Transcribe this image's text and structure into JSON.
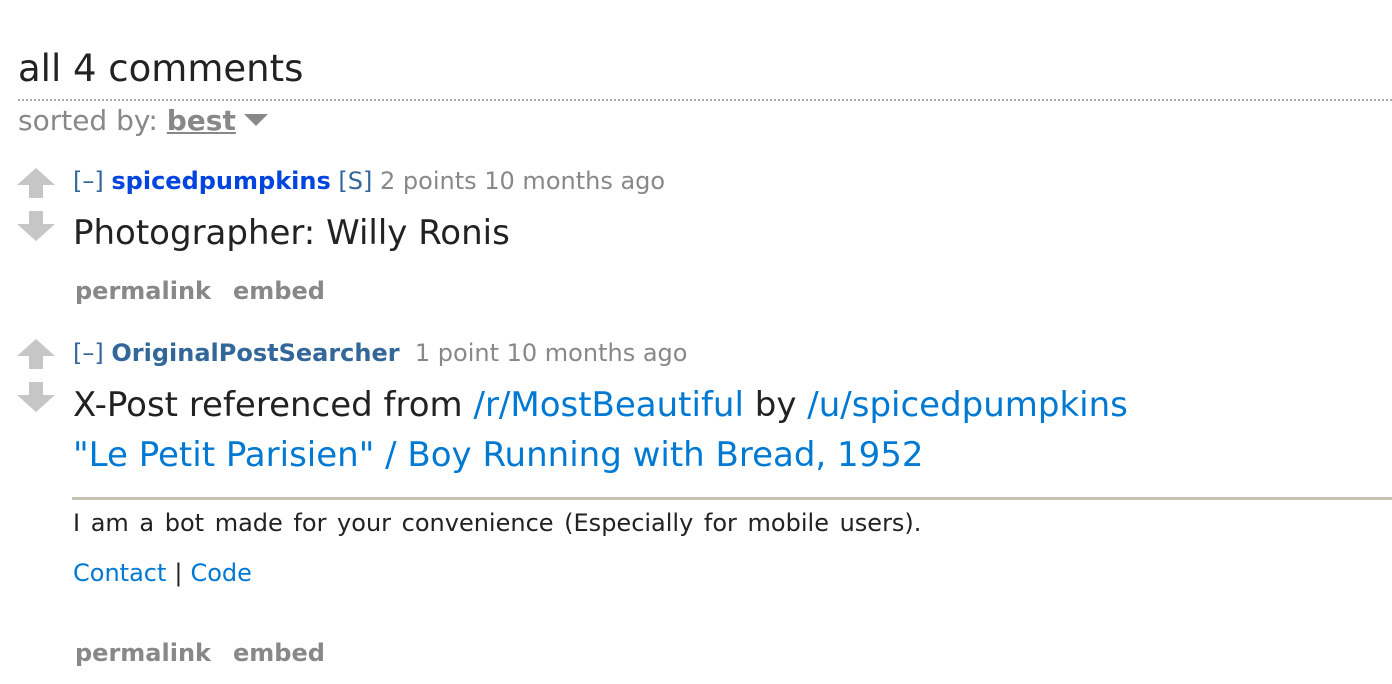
{
  "header": {
    "title": "all 4 comments",
    "sort_label": "sorted by: ",
    "sort_value": "best"
  },
  "comments": [
    {
      "expand": "[–]",
      "author": "spicedpumpkins",
      "submitter_tag": "[S]",
      "score": "2 points",
      "time": "10 months ago",
      "body": "Photographer: Willy Ronis",
      "buttons": [
        "permalink",
        "embed"
      ]
    },
    {
      "expand": "[–]",
      "author": "OriginalPostSearcher",
      "score": "1 point",
      "time": "10 months ago",
      "body_prefix": "X-Post referenced from ",
      "subreddit_link": "/r/MostBeautiful",
      "body_middle": " by ",
      "user_link": "/u/spicedpumpkins",
      "post_link": "\"Le Petit Parisien\" / Boy Running with Bread, 1952",
      "bot_note": "I am a bot made for your convenience (Especially for mobile users).",
      "footer_links": [
        "Contact",
        "Code"
      ],
      "footer_separator": "|",
      "buttons": [
        "permalink",
        "embed"
      ]
    }
  ],
  "colors": {
    "link": "#0079d3",
    "author": "#0045dd",
    "meta": "#888888",
    "arrow": "#c6c6c6"
  }
}
